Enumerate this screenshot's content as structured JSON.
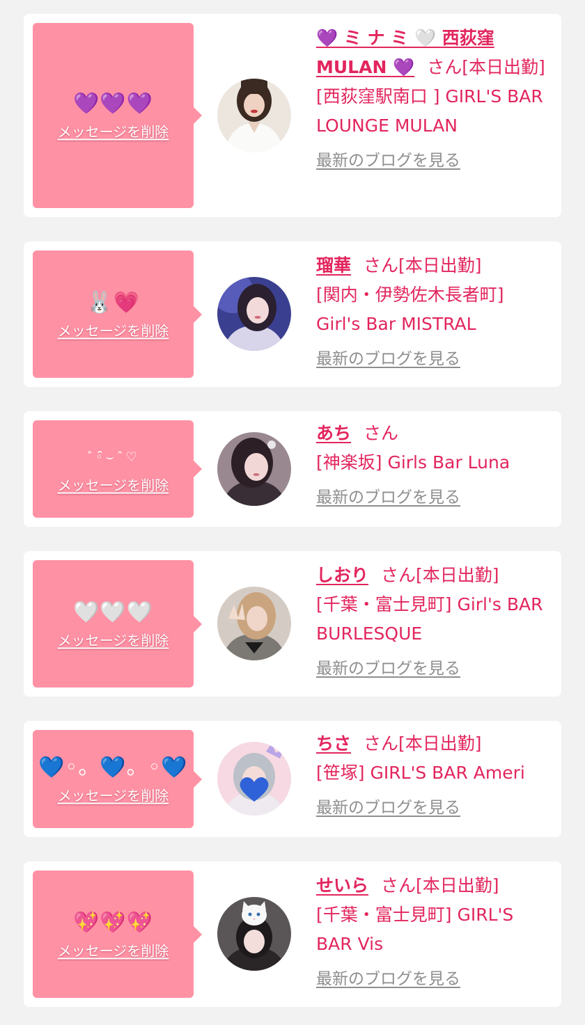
{
  "delete_label": "メッセージを削除",
  "blog_label": "最新のブログを見る",
  "colors": {
    "bubble": "#ff91a4",
    "accent": "#e2255d",
    "blog_link": "#8e8e8e",
    "background": "#f2f2f2"
  },
  "items": [
    {
      "message": "💜💜💜",
      "name": "💜 ミ ナ ミ 🤍 西荻窪 MULAN 💜",
      "suffix": "さん[本日出勤]",
      "shop": "[西荻窪駅南口 ] GIRL'S BAR LOUNGE MULAN",
      "avatar_icon": "girl-portrait-white-blouse"
    },
    {
      "message": "🐰💗",
      "name": "瑠華",
      "suffix": "さん[本日出勤]",
      "shop": "[関内・伊勢佐木長者町] Girl's Bar MISTRAL",
      "avatar_icon": "girl-portrait-blue-light"
    },
    {
      "message": "ˆ◦̑̑⌣ˆ♡",
      "name": "あち",
      "suffix": "さん",
      "shop": "[神楽坂] Girls Bar Luna",
      "avatar_icon": "girl-portrait-dark-hair"
    },
    {
      "message": "🤍🤍🤍",
      "name": "しおり",
      "suffix": "さん[本日出勤]",
      "shop": "[千葉・富士見町] Girl's BAR BURLESQUE",
      "avatar_icon": "girl-portrait-peace-sign"
    },
    {
      "message": "💙◦。💙。◦💙",
      "name": "ちさ",
      "suffix": "さん[本日出勤]",
      "shop": "[笹塚] GIRL'S BAR Ameri",
      "avatar_icon": "girl-portrait-blue-heart-sticker"
    },
    {
      "message": "💖💖💖",
      "name": "せいら",
      "suffix": "さん[本日出勤]",
      "shop": "[千葉・富士見町] GIRL'S BAR Vis",
      "avatar_icon": "girl-portrait-cat-filter"
    }
  ]
}
